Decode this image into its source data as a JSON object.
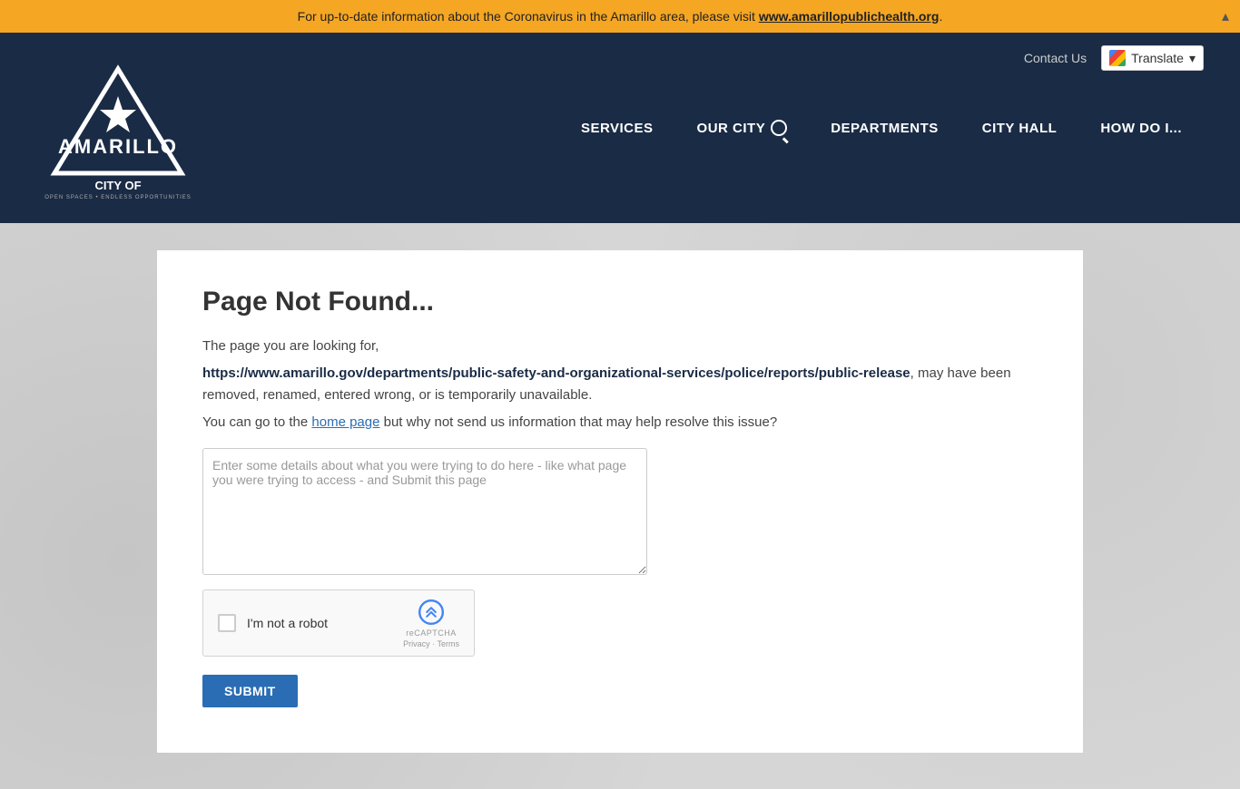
{
  "announcement": {
    "text": "For up-to-date information about the Coronavirus in the Amarillo area, please visit ",
    "link_text": "www.amarillopublichealth.org",
    "link_url": "http://www.amarillopublichealth.org",
    "suffix": "."
  },
  "header": {
    "contact_us_label": "Contact Us",
    "translate_label": "Translate",
    "logo_alt": "City of Amarillo",
    "logo_tagline": "OPEN SPACES • ENDLESS OPPORTUNITIES"
  },
  "nav": {
    "items": [
      {
        "label": "SERVICES",
        "id": "services"
      },
      {
        "label": "OUR CITY",
        "id": "our-city",
        "has_search": true
      },
      {
        "label": "DEPARTMENTS",
        "id": "departments"
      },
      {
        "label": "CITY HALL",
        "id": "city-hall"
      },
      {
        "label": "HOW DO I...",
        "id": "how-do-i"
      }
    ]
  },
  "main": {
    "title": "Page Not Found...",
    "error_intro": "The page you are looking for,",
    "error_url": "https://www.amarillo.gov/departments/public-safety-and-organizational-services/police/reports/public-release",
    "error_suffix": ", may have been removed, renamed, entered wrong, or is temporarily unavailable.",
    "help_prefix": "You can go to the ",
    "home_page_label": "home page",
    "help_suffix": " but why not send us information that may help resolve this issue?",
    "textarea_placeholder": "Enter some details about what you were trying to do here - like what page you were trying to access - and Submit this page",
    "captcha_label": "I'm not a robot",
    "captcha_brand": "reCAPTCHA",
    "captcha_privacy": "Privacy",
    "captcha_terms": "Terms",
    "submit_label": "SUBMIT"
  },
  "colors": {
    "announcement_bg": "#f5a623",
    "header_bg": "#1a2b45",
    "submit_bg": "#2a6db5"
  }
}
